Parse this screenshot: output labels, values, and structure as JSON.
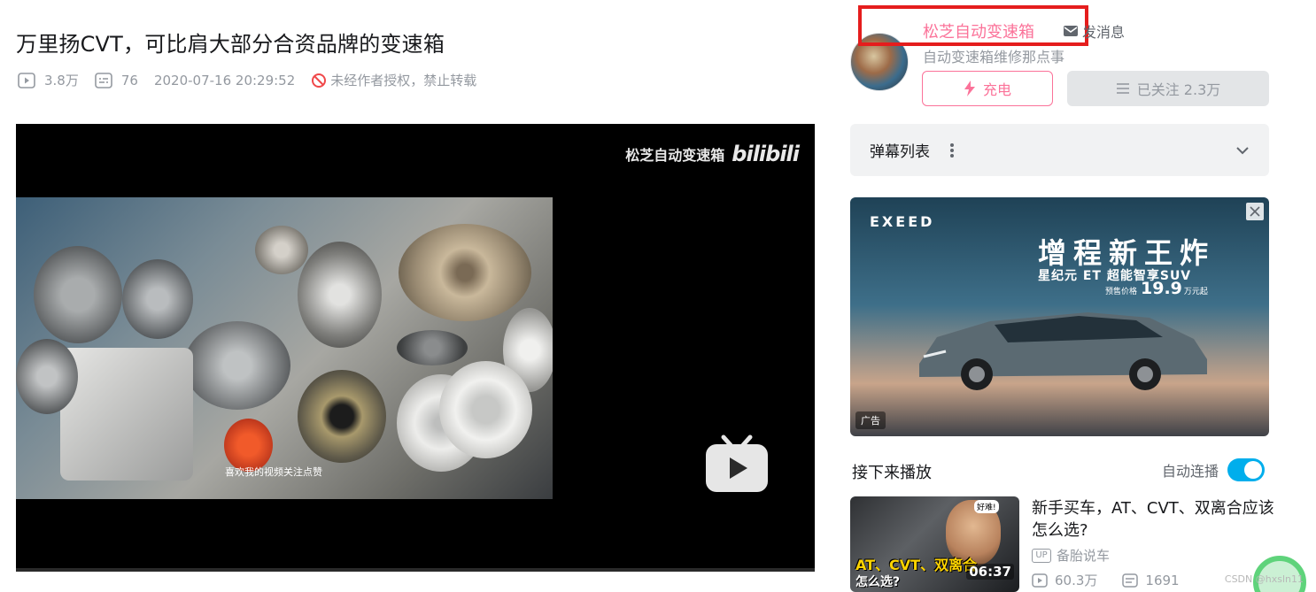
{
  "video": {
    "title": "万里扬CVT，可比肩大部分合资品牌的变速箱",
    "views": "3.8万",
    "danmaku_count": "76",
    "publish_time": "2020-07-16 20:29:52",
    "copyright": "未经作者授权，禁止转载"
  },
  "player": {
    "watermark_name": "松芝自动变速箱",
    "watermark_logo": "bilibili",
    "subtitle": "喜欢我的视频关注点赞"
  },
  "uploader": {
    "name": "松芝自动变速箱",
    "message_label": "发消息",
    "description": "自动变速箱维修那点事",
    "charge_label": "充电",
    "follow_label": "已关注 2.3万"
  },
  "danmaku_panel": {
    "title": "弹幕列表"
  },
  "ad": {
    "brand": "EXEED",
    "headline": "增程新王炸",
    "subline": "星纪元 ET 超能智享SUV",
    "price_label": "预售价格",
    "price": "19.9",
    "price_unit": "万元起",
    "tag": "广告"
  },
  "up_next": {
    "title": "接下来播放",
    "autoplay_label": "自动连播",
    "autoplay_on": true
  },
  "recommendation": {
    "title": "新手买车，AT、CVT、双离合应该怎么选?",
    "uploader": "备胎说车",
    "up_tag": "UP",
    "views": "60.3万",
    "danmaku": "1691",
    "duration": "06:37",
    "thumb_caption": "AT、CVT、双离合",
    "thumb_caption2": "怎么选?",
    "thumb_badge": "好难!"
  },
  "watermark_footer": "CSDN @hxsln11",
  "colors": {
    "brand_pink": "#fb7299",
    "brand_blue": "#00aeec",
    "highlight_red": "#e51d1d"
  }
}
